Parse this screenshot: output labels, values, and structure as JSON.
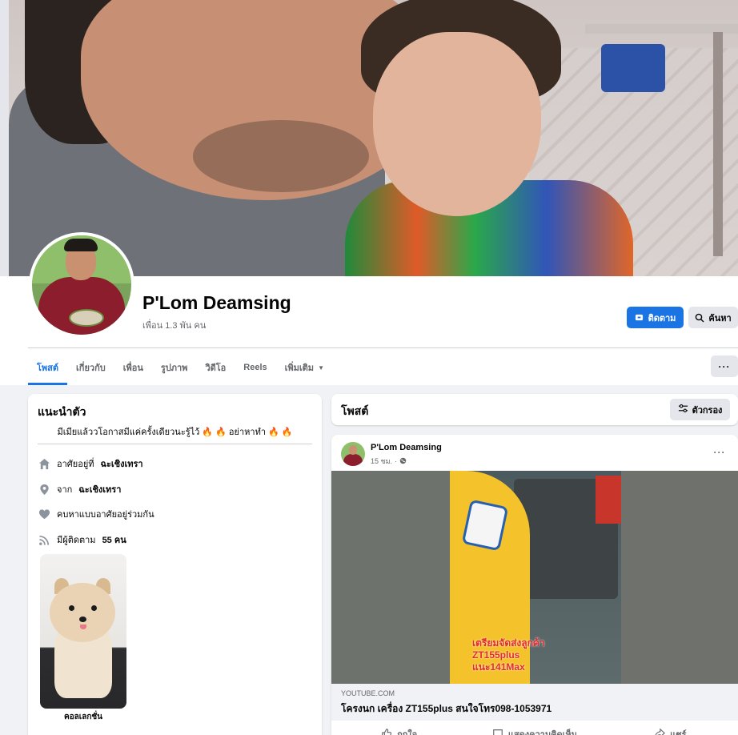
{
  "profile": {
    "name": "P'Lom Deamsing",
    "friends": "เพื่อน 1.3 พัน คน"
  },
  "buttons": {
    "follow": "ติดตาม",
    "search": "ค้นหา",
    "more": "···"
  },
  "tabs": [
    {
      "label": "โพสต์"
    },
    {
      "label": "เกี่ยวกับ"
    },
    {
      "label": "เพื่อน"
    },
    {
      "label": "รูปภาพ"
    },
    {
      "label": "วิดีโอ"
    },
    {
      "label": "Reels"
    },
    {
      "label": "เพิ่มเติม"
    }
  ],
  "intro": {
    "title": "แนะนำตัว",
    "bio": "มีเมียแล้ววโอกาสมีแค่ครั้งเดียวนะรู้ไว้ 🔥 🔥 อย่าหาทำ 🔥 🔥",
    "rows": [
      {
        "icon": "home-icon",
        "prefix": "อาศัยอยู่ที่",
        "value": "ฉะเชิงเทรา"
      },
      {
        "icon": "location-pin-icon",
        "prefix": "จาก",
        "value": "ฉะเชิงเทรา"
      },
      {
        "icon": "heart-icon",
        "prefix": "คบหาแบบอาศัยอยู่ร่วมกัน",
        "value": ""
      },
      {
        "icon": "rss-icon",
        "prefix": "มีผู้ติดตาม",
        "value": "55 คน"
      }
    ],
    "featured_caption": "คอลเลกชั่น"
  },
  "posts_section": {
    "title": "โพสต์",
    "filter_label": "ตัวกรอง"
  },
  "post": {
    "author": "P'Lom Deamsing",
    "time": "15 ชม.",
    "media_text": [
      "เตรียมจัดส่งลูกค้า",
      "ZT155plus",
      "แนะ141Max"
    ],
    "link_domain": "YOUTUBE.COM",
    "link_title": "โครงนก เครื่อง ZT155plus สนใจโทร098-1053971",
    "actions": {
      "like": "ถูกใจ",
      "comment": "แสดงความคิดเห็น",
      "share": "แชร์"
    }
  },
  "colors": {
    "accent": "#1b74e4",
    "page_bg": "#f0f2f5",
    "secondary_text": "#65676b"
  }
}
